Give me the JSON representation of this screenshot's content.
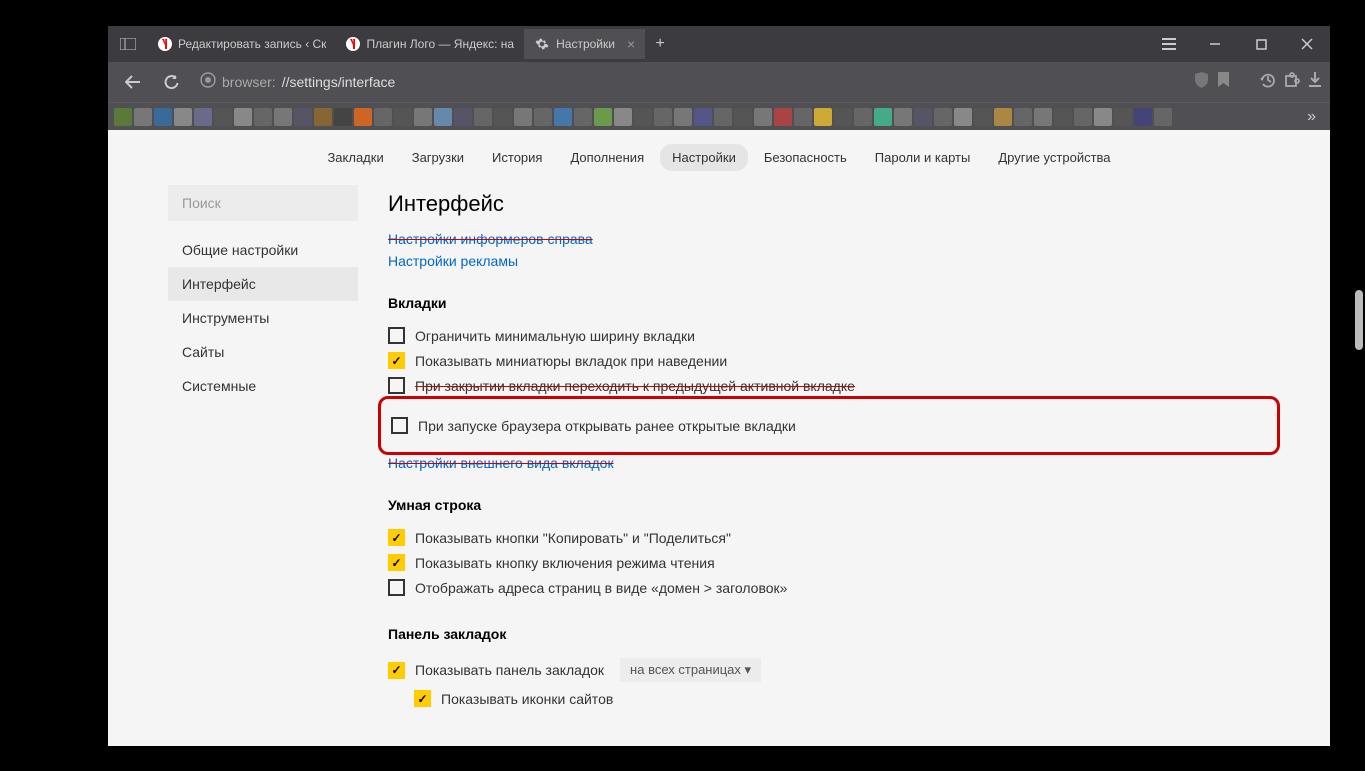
{
  "tabs": [
    {
      "title": "Редактировать запись ‹ Ск"
    },
    {
      "title": "Плагин Лого — Яндекс: на"
    },
    {
      "title": "Настройки"
    }
  ],
  "url": {
    "scheme": "browser:",
    "path": "//settings/interface"
  },
  "topnav": [
    "Закладки",
    "Загрузки",
    "История",
    "Дополнения",
    "Настройки",
    "Безопасность",
    "Пароли и карты",
    "Другие устройства"
  ],
  "search_placeholder": "Поиск",
  "sidenav": [
    "Общие настройки",
    "Интерфейс",
    "Инструменты",
    "Сайты",
    "Системные"
  ],
  "page_title": "Интерфейс",
  "links": {
    "informers": "Настройки информеров справа",
    "ads": "Настройки рекламы",
    "tab_appearance": "Настройки внешнего вида вкладок"
  },
  "sections": {
    "tabs": "Вкладки",
    "smartline": "Умная строка",
    "bookmarks_panel": "Панель закладок"
  },
  "opts": {
    "limit_width": "Ограничить минимальную ширину вкладки",
    "show_thumbs": "Показывать миниатюры вкладок при наведении",
    "on_close": "При закрытии вкладки переходить к предыдущей активной вкладке",
    "on_start": "При запуске браузера открывать ранее открытые вкладки",
    "copy_share": "Показывать кнопки \"Копировать\" и \"Поделиться\"",
    "reader": "Показывать кнопку включения режима чтения",
    "domain_title": "Отображать адреса страниц в виде «домен > заголовок»",
    "show_panel": "Показывать панель закладок",
    "show_icons": "Показывать иконки сайтов"
  },
  "dropdown": {
    "panel_pages": "на всех страницах ▾"
  }
}
